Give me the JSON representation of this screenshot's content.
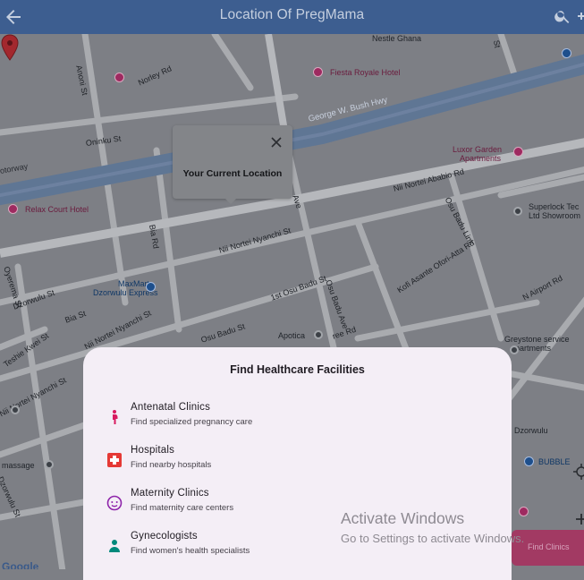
{
  "app_bar": {
    "title": "Location Of PregMama",
    "back_icon": "arrow-left-icon",
    "search_icon": "search-icon",
    "more_icon": "more-vert-icon"
  },
  "map": {
    "roads": {
      "norley": "Norley Rd",
      "anoni": "Anoni St",
      "oninku": "Oninku St",
      "bush_hwy": "George W. Bush Hwy",
      "motorway": "otorway",
      "bia": "Bia Rd",
      "nii_nortei_nyanchi_st": "Nii Nortei Nyanchi St",
      "nii_nortei_nyanchi_st_2": "Nii Nortei Nyanchi St",
      "osu_badu_ave": "Osu Badu Ave",
      "osu_badu_ave_2": "Osu Badu Ave",
      "first_osu_badu": "1st Osu Badu St",
      "osu_badu_st": "Osu Badu St",
      "nii_nortei_ababio": "Nii Nortei Ababio Rd",
      "osu_badu_link": "Osu Badu Link",
      "kofi_asante": "Kofi Asante Ofori-Atta Rd",
      "n_airport": "N Airport Rd",
      "oyerema": "Oyerema St",
      "bia_st": "Bia St",
      "dzorwulu_st": "Dzorwulu St",
      "dzorwulu_st_2": "Dzorwulu St",
      "teshie_kwei": "Teshie Kwei St",
      "ree_rd": "ree Rd",
      "lower_st": "St",
      "ave_short": "Ave"
    },
    "pois": {
      "fiesta": "Fiesta Royale Hotel",
      "nestle": "Nestle Ghana",
      "luxor_1": "Luxor Garden",
      "luxor_2": "Apartments",
      "superlock_1": "Superlock Tec",
      "superlock_2": "Ltd Showroom",
      "relax": "Relax Court Hotel",
      "maxmart_1": "MaxMart",
      "maxmart_2": "Dzorwulu Express",
      "apotica": "Apotica",
      "greystone_1": "Greystone service",
      "greystone_2": "apartments",
      "dzorwulu": "Dzorwulu",
      "bubbl": "BUBBLE",
      "massage": "massage"
    },
    "info_window": {
      "text": "Your Current Location",
      "close_icon": "close-icon"
    },
    "google_logo": "Google",
    "marker_color": "#a3282e"
  },
  "sheet": {
    "heading": "Find Healthcare Facilities",
    "items": [
      {
        "title": "Antenatal Clinics",
        "subtitle": "Find specialized pregnancy care",
        "icon": "pregnant-woman-icon",
        "color": "#d81b60"
      },
      {
        "title": "Hospitals",
        "subtitle": "Find nearby hospitals",
        "icon": "hospital-icon",
        "color": "#e53935"
      },
      {
        "title": "Maternity Clinics",
        "subtitle": "Find maternity care centers",
        "icon": "baby-face-icon",
        "color": "#8e24aa"
      },
      {
        "title": "Gynecologists",
        "subtitle": "Find women's health specialists",
        "icon": "person-icon",
        "color": "#00897b"
      }
    ]
  },
  "watermark": {
    "line1": "Activate Windows",
    "line2": "Go to Settings to activate Windows."
  },
  "fab": {
    "label": "Find Clinics"
  },
  "colors": {
    "app_bar": "#3d5e90",
    "sheet": "#f4eef6",
    "map": "#7d7f85"
  }
}
